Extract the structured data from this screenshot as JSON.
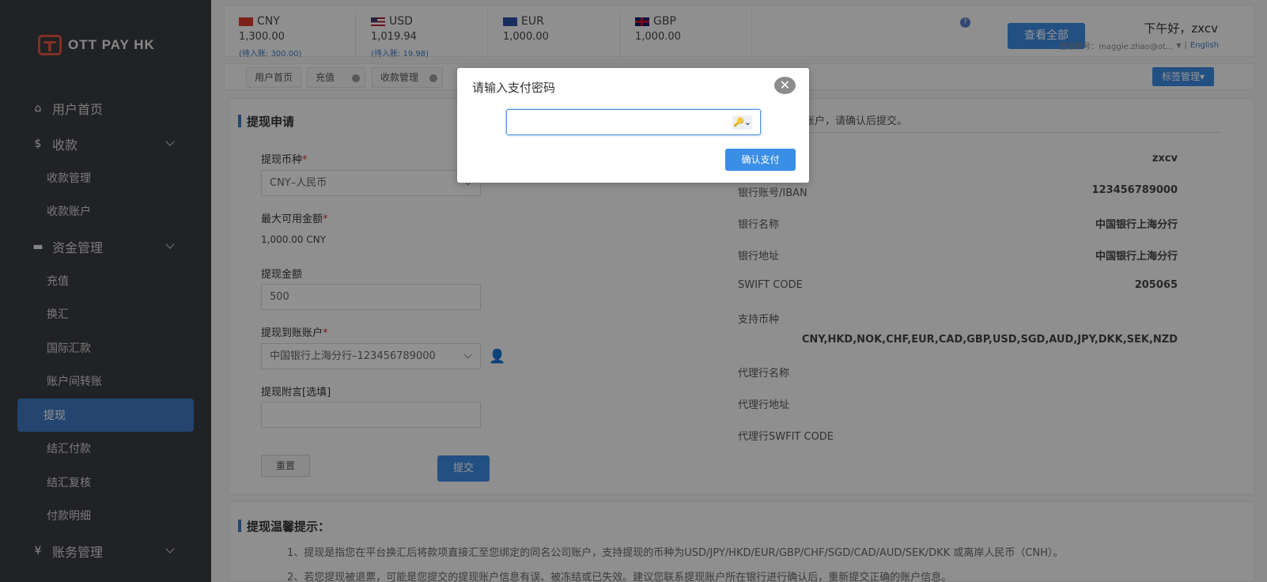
{
  "brand": {
    "name": "OTT PAY HK"
  },
  "sidebar": {
    "items": [
      {
        "label": "用户首页",
        "icon": "home-icon",
        "glyph": "⌂"
      },
      {
        "label": "收款",
        "icon": "dollar-icon",
        "glyph": "$"
      },
      {
        "label": "收款管理"
      },
      {
        "label": "收款账户"
      },
      {
        "label": "资金管理",
        "icon": "card-icon",
        "glyph": "▬"
      },
      {
        "label": "充值"
      },
      {
        "label": "换汇"
      },
      {
        "label": "国际汇款"
      },
      {
        "label": "账户间转账"
      },
      {
        "label": "提现",
        "active": true
      },
      {
        "label": "结汇付款"
      },
      {
        "label": "结汇复核"
      },
      {
        "label": "付款明细"
      },
      {
        "label": "账务管理",
        "icon": "yen-icon",
        "glyph": "¥"
      }
    ]
  },
  "balances": [
    {
      "code": "CNY",
      "amount": "1,300.00",
      "pending": "(待入账: 300.00)"
    },
    {
      "code": "USD",
      "amount": "1,019.94",
      "pending": "(待入账: 19.98)"
    },
    {
      "code": "EUR",
      "amount": "1,000.00",
      "pending": ""
    },
    {
      "code": "GBP",
      "amount": "1,000.00",
      "pending": ""
    }
  ],
  "header": {
    "help_glyph": "?",
    "view_all": "查看全部",
    "greeting": "下午好，zxcv",
    "login_label": "登录账号：maggie.zhao@ot...",
    "divider": "|",
    "language": "English"
  },
  "tabs": [
    {
      "label": "用户首页"
    },
    {
      "label": "充值"
    },
    {
      "label": "收款管理"
    }
  ],
  "tag_manage": "标签管理▾",
  "form": {
    "title": "提现申请",
    "currency_label": "提现币种",
    "currency_value": "CNY–人民币",
    "max_label": "最大可用金额",
    "max_value": "1,000.00 CNY",
    "amount_label": "提现金额",
    "amount_value": "500",
    "account_label": "提现到账账户",
    "account_value": "中国银行上海分行–123456789000",
    "note_label": "提现附言[选填]",
    "reset": "重置",
    "submit": "提交"
  },
  "account_info": {
    "note": "下账户，请确认后提交。",
    "rows": [
      {
        "key": "",
        "value": "zxcv"
      },
      {
        "key": "银行账号/IBAN",
        "value": "123456789000"
      },
      {
        "key": "银行名称",
        "value": "中国银行上海分行"
      },
      {
        "key": "银行地址",
        "value": "中国银行上海分行"
      },
      {
        "key": "SWIFT CODE",
        "value": "205065"
      },
      {
        "key": "支持币种",
        "value": ""
      },
      {
        "key": "代理行名称",
        "value": ""
      },
      {
        "key": "代理行地址",
        "value": ""
      },
      {
        "key": "代理行SWFIT CODE",
        "value": ""
      }
    ],
    "supported_currencies": "CNY,HKD,NOK,CHF,EUR,CAD,GBP,USD,SGD,AUD,JPY,DKK,SEK,NZD"
  },
  "tips": {
    "title": "提现温馨提示：",
    "lines": [
      "1、提现是指您在平台换汇后将款项直接汇至您绑定的同名公司账户，支持提现的币种为USD/JPY/HKD/EUR/GBP/CHF/SGD/CAD/AUD/SEK/DKK 或离岸人民币（CNH）。",
      "2、若您提现被退票，可能是您提交的提现账户信息有误、被冻结或已失效。建议您联系提现账户所在银行进行确认后，重新提交正确的账户信息。"
    ]
  },
  "modal": {
    "title": "请输入支付密码",
    "close_glyph": "✕",
    "key_glyph": "🔑⌄",
    "password_value": "",
    "confirm": "确认支付"
  }
}
